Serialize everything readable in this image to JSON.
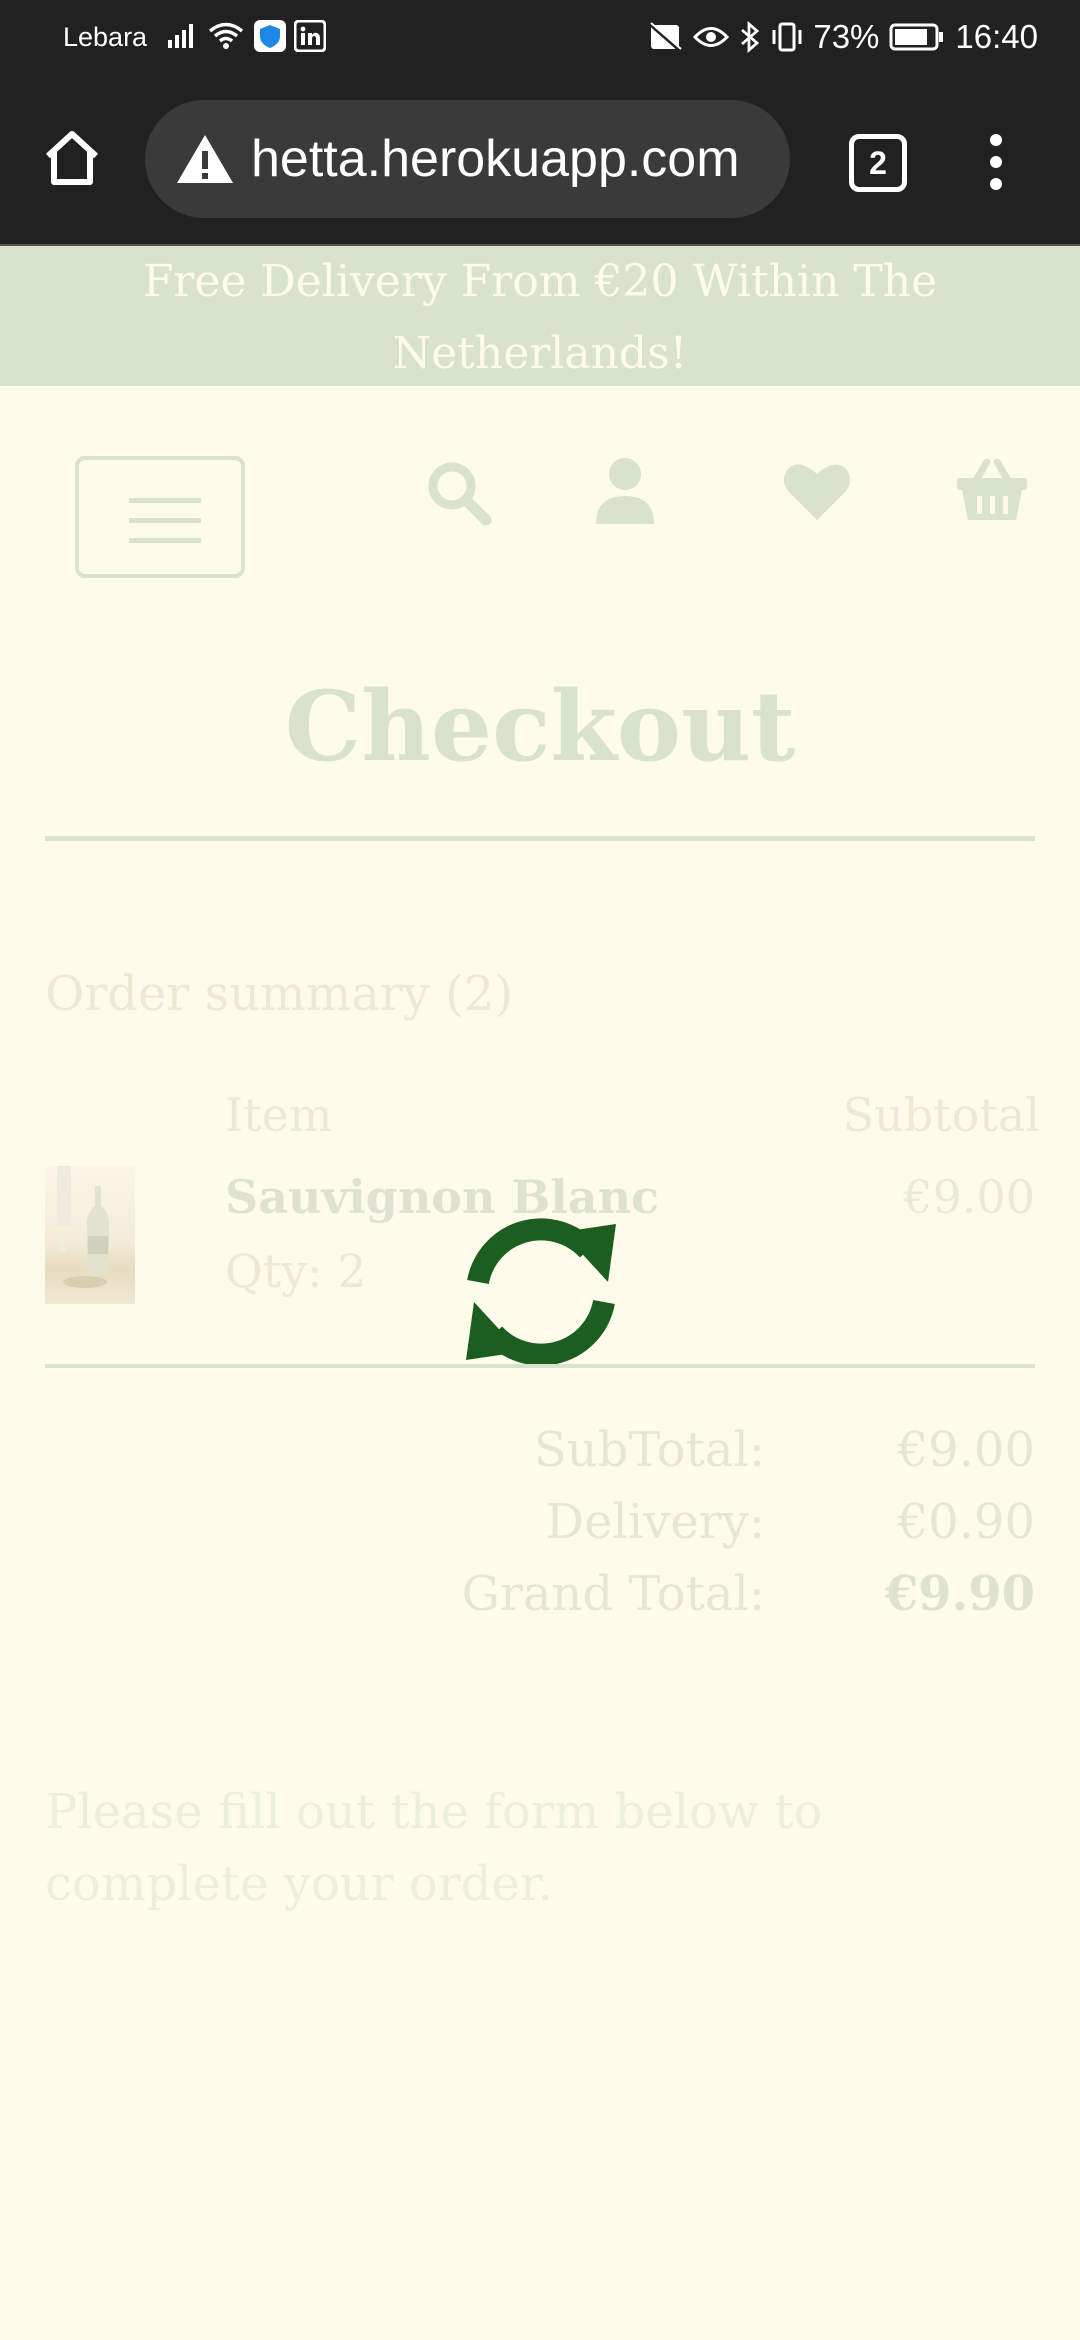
{
  "status_bar": {
    "carrier": "Lebara",
    "battery": "73%",
    "time": "16:40"
  },
  "browser": {
    "url": "hetta.herokuapp.com",
    "tab_count": "2"
  },
  "banner": {
    "line1": "Free Delivery From €20 Within The",
    "line2": "Netherlands!"
  },
  "page": {
    "title": "Checkout",
    "order_summary": "Order summary (2)",
    "columns": {
      "item": "Item",
      "subtotal": "Subtotal"
    },
    "product": {
      "name": "Sauvignon Blanc",
      "qty": "Qty: 2",
      "price": "€9.00"
    },
    "totals": {
      "subtotal_label": "SubTotal:",
      "subtotal_value": "€9.00",
      "delivery_label": "Delivery:",
      "delivery_value": "€0.90",
      "grand_label": "Grand Total:",
      "grand_value": "€9.90"
    },
    "instructions": "Please fill out the form below to complete your order."
  },
  "icons": [
    "home-icon",
    "warning-icon",
    "menu-dots-icon",
    "search-icon",
    "user-icon",
    "heart-icon",
    "basket-icon",
    "refresh-spinner-icon"
  ],
  "colors": {
    "background": "#fffbea",
    "accent": "#d9e2cc",
    "spinner": "#1b5e20"
  }
}
